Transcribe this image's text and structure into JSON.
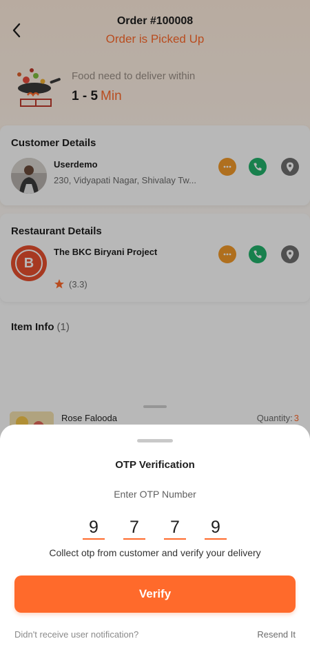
{
  "header": {
    "order_title": "Order #100008",
    "order_status": "Order is Picked Up"
  },
  "delivery": {
    "label": "Food need to deliver within",
    "time_range": "1 - 5",
    "time_unit": "Min"
  },
  "customer": {
    "section_title": "Customer Details",
    "name": "Userdemo",
    "address": "230, Vidyapati Nagar, Shivalay Tw..."
  },
  "restaurant": {
    "section_title": "Restaurant Details",
    "name": "The BKC Biryani Project",
    "initial": "B",
    "rating": "(3.3)"
  },
  "items": {
    "section_title": "Item Info",
    "count": "(1)",
    "list": [
      {
        "name": "Rose Falooda",
        "quantity_label": "Quantity:",
        "quantity": "3"
      }
    ]
  },
  "otp_sheet": {
    "title": "OTP Verification",
    "subtitle": "Enter OTP Number",
    "digits": [
      "9",
      "7",
      "7",
      "9"
    ],
    "hint": "Collect otp from customer and verify your delivery",
    "verify_label": "Verify",
    "no_notification_text": "Didn't receive user notification?",
    "resend_label": "Resend It"
  },
  "colors": {
    "accent": "#ff6a2b",
    "call": "#22b26b",
    "chat": "#f39a2a",
    "location": "#6f6f6f"
  },
  "icons": {
    "back": "chevron-left-icon",
    "chat": "chat-icon",
    "call": "phone-icon",
    "location": "location-pin-icon",
    "star": "star-icon"
  }
}
